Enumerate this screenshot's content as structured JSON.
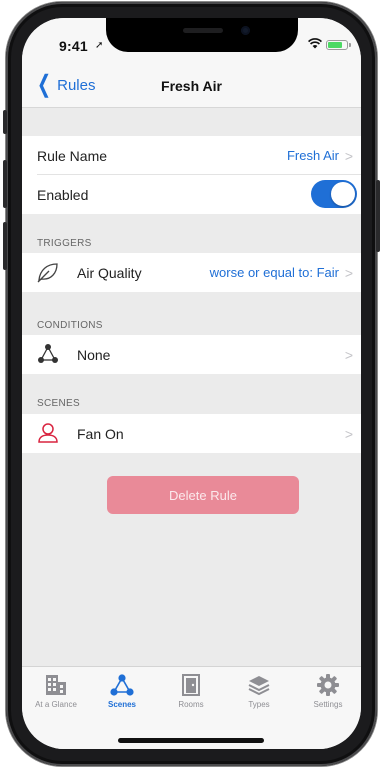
{
  "status_bar": {
    "time": "9:41",
    "battery_level": 0.75
  },
  "nav": {
    "back_label": "Rules",
    "title": "Fresh Air"
  },
  "rule": {
    "name_label": "Rule Name",
    "name_value": "Fresh Air",
    "enabled_label": "Enabled",
    "enabled": true
  },
  "triggers": {
    "header": "TRIGGERS",
    "items": [
      {
        "icon": "leaf-icon",
        "label": "Air Quality",
        "value": "worse or equal to: Fair"
      }
    ]
  },
  "conditions": {
    "header": "CONDITIONS",
    "items": [
      {
        "icon": "network-icon",
        "label": "None"
      }
    ]
  },
  "scenes": {
    "header": "SCENES",
    "items": [
      {
        "icon": "person-icon",
        "label": "Fan On"
      }
    ]
  },
  "delete_button": {
    "label": "Delete Rule"
  },
  "tab_bar": {
    "active": "Scenes",
    "tabs": [
      {
        "label": "At a Glance",
        "icon": "building-icon"
      },
      {
        "label": "Scenes",
        "icon": "scenes-icon"
      },
      {
        "label": "Rooms",
        "icon": "door-icon"
      },
      {
        "label": "Types",
        "icon": "layers-icon"
      },
      {
        "label": "Settings",
        "icon": "gear-icon"
      }
    ]
  },
  "colors": {
    "accent": "#1f6fd6",
    "delete": "#e98a98",
    "scene_icon": "#d9233f",
    "background": "#ebebeb"
  }
}
